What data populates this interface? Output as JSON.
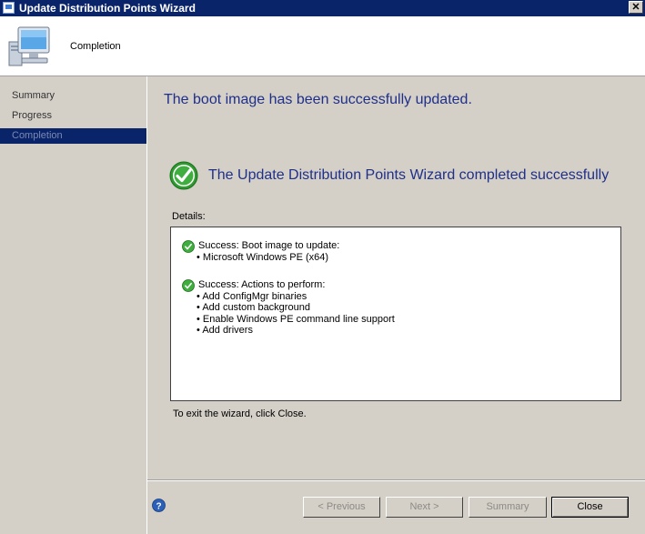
{
  "window": {
    "title": "Update Distribution Points Wizard",
    "close_glyph": "✕"
  },
  "header": {
    "page_name": "Completion",
    "icon": "computer-monitor-icon"
  },
  "sidebar": {
    "items": [
      {
        "label": "Summary",
        "active": false
      },
      {
        "label": "Progress",
        "active": false
      },
      {
        "label": "Completion",
        "active": true
      }
    ]
  },
  "main": {
    "headline": "The boot image has been successfully updated.",
    "status": "The Update Distribution Points Wizard completed successfully",
    "details_label": "Details:",
    "entries": [
      {
        "header": "Success: Boot image to update:",
        "bullets": [
          "Microsoft Windows PE (x64)"
        ]
      },
      {
        "header": "Success: Actions to perform:",
        "bullets": [
          "Add ConfigMgr binaries",
          "Add custom background",
          "Enable Windows PE command line support",
          "Add drivers"
        ]
      }
    ],
    "exit_text": "To exit the wizard, click Close."
  },
  "footer": {
    "previous_label": "< Previous",
    "next_label": "Next >",
    "summary_label": "Summary",
    "close_label": "Close"
  },
  "colors": {
    "title_bar": "#0a246a",
    "headline_text": "#1f2f8a",
    "success_green": "#2f9a2f"
  }
}
